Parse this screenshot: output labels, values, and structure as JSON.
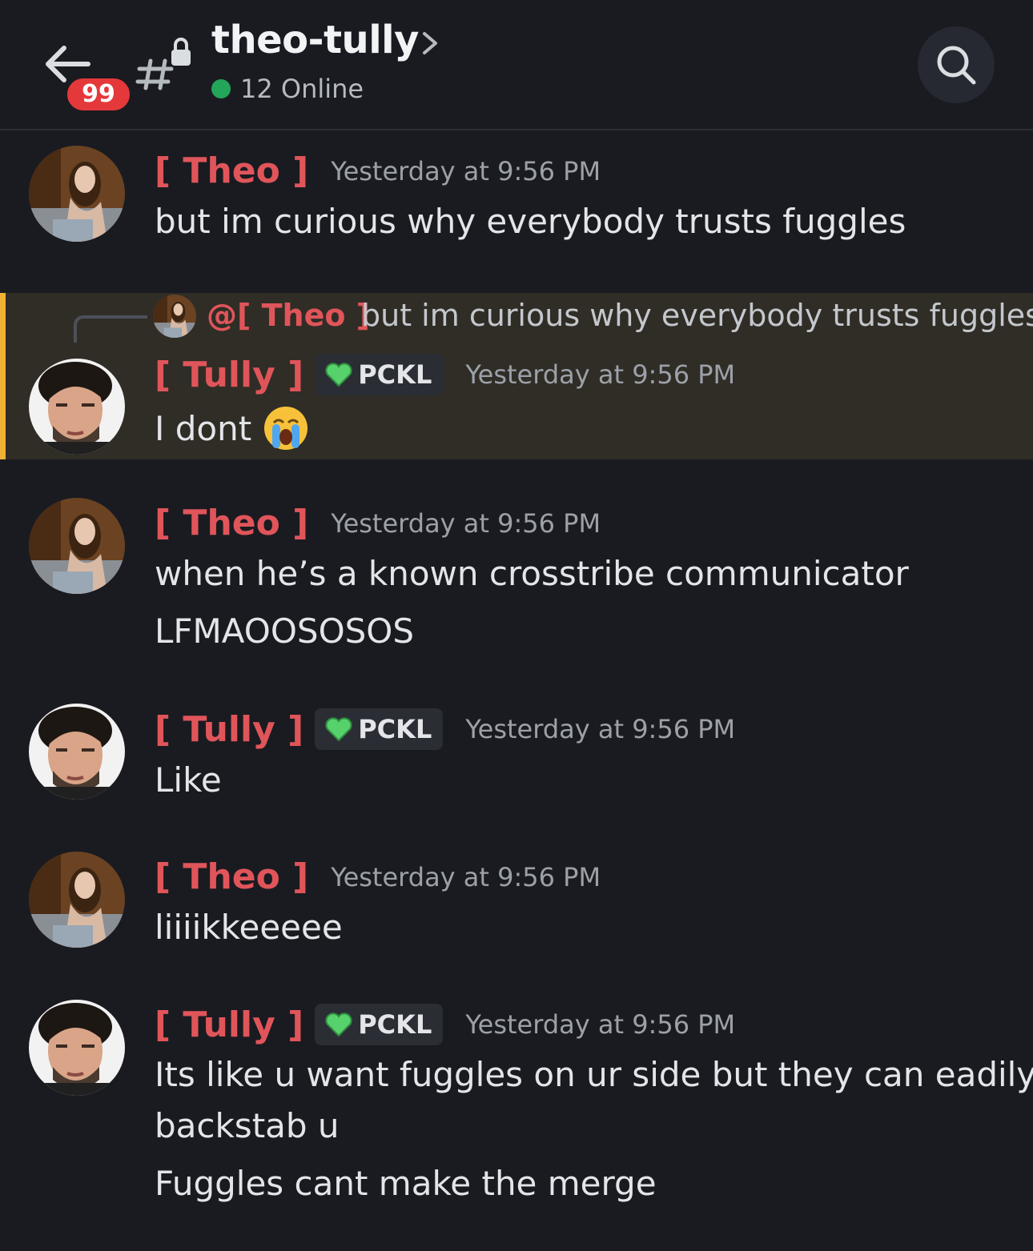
{
  "header": {
    "back_badge": "99",
    "channel_name": "theo-tully",
    "online_text": "12 Online"
  },
  "reply": {
    "mention": "@[ Theo ]",
    "text": "but im curious why everybody trusts fuggles"
  },
  "messages": [
    {
      "author": "[ Theo ]",
      "timestamp": "Yesterday at 9:56 PM",
      "lines": [
        "but im curious why everybody trusts fuggles"
      ]
    },
    {
      "author": "[ Tully ]",
      "tag": "PCKL",
      "timestamp": "Yesterday at 9:56 PM",
      "lines": [
        "I dont"
      ],
      "emoji": "loudly-crying-face"
    },
    {
      "author": "[ Theo ]",
      "timestamp": "Yesterday at 9:56 PM",
      "lines": [
        "when he’s a known crosstribe communicator",
        "LFMAOOSOSOS"
      ]
    },
    {
      "author": "[ Tully ]",
      "tag": "PCKL",
      "timestamp": "Yesterday at 9:56 PM",
      "lines": [
        "Like"
      ]
    },
    {
      "author": "[ Theo ]",
      "timestamp": "Yesterday at 9:56 PM",
      "lines": [
        "liiiikkeeeee"
      ]
    },
    {
      "author": "[ Tully ]",
      "tag": "PCKL",
      "timestamp": "Yesterday at 9:56 PM",
      "lines": [
        "Its like u want fuggles on ur side but they can eadily",
        "backstab u",
        "Fuggles cant make the merge"
      ]
    }
  ],
  "colors": {
    "background": "#1a1b21",
    "name": "#e0555a",
    "highlight": "#2f2d26",
    "highlight_bar": "#f0b232",
    "online": "#23a55a"
  }
}
